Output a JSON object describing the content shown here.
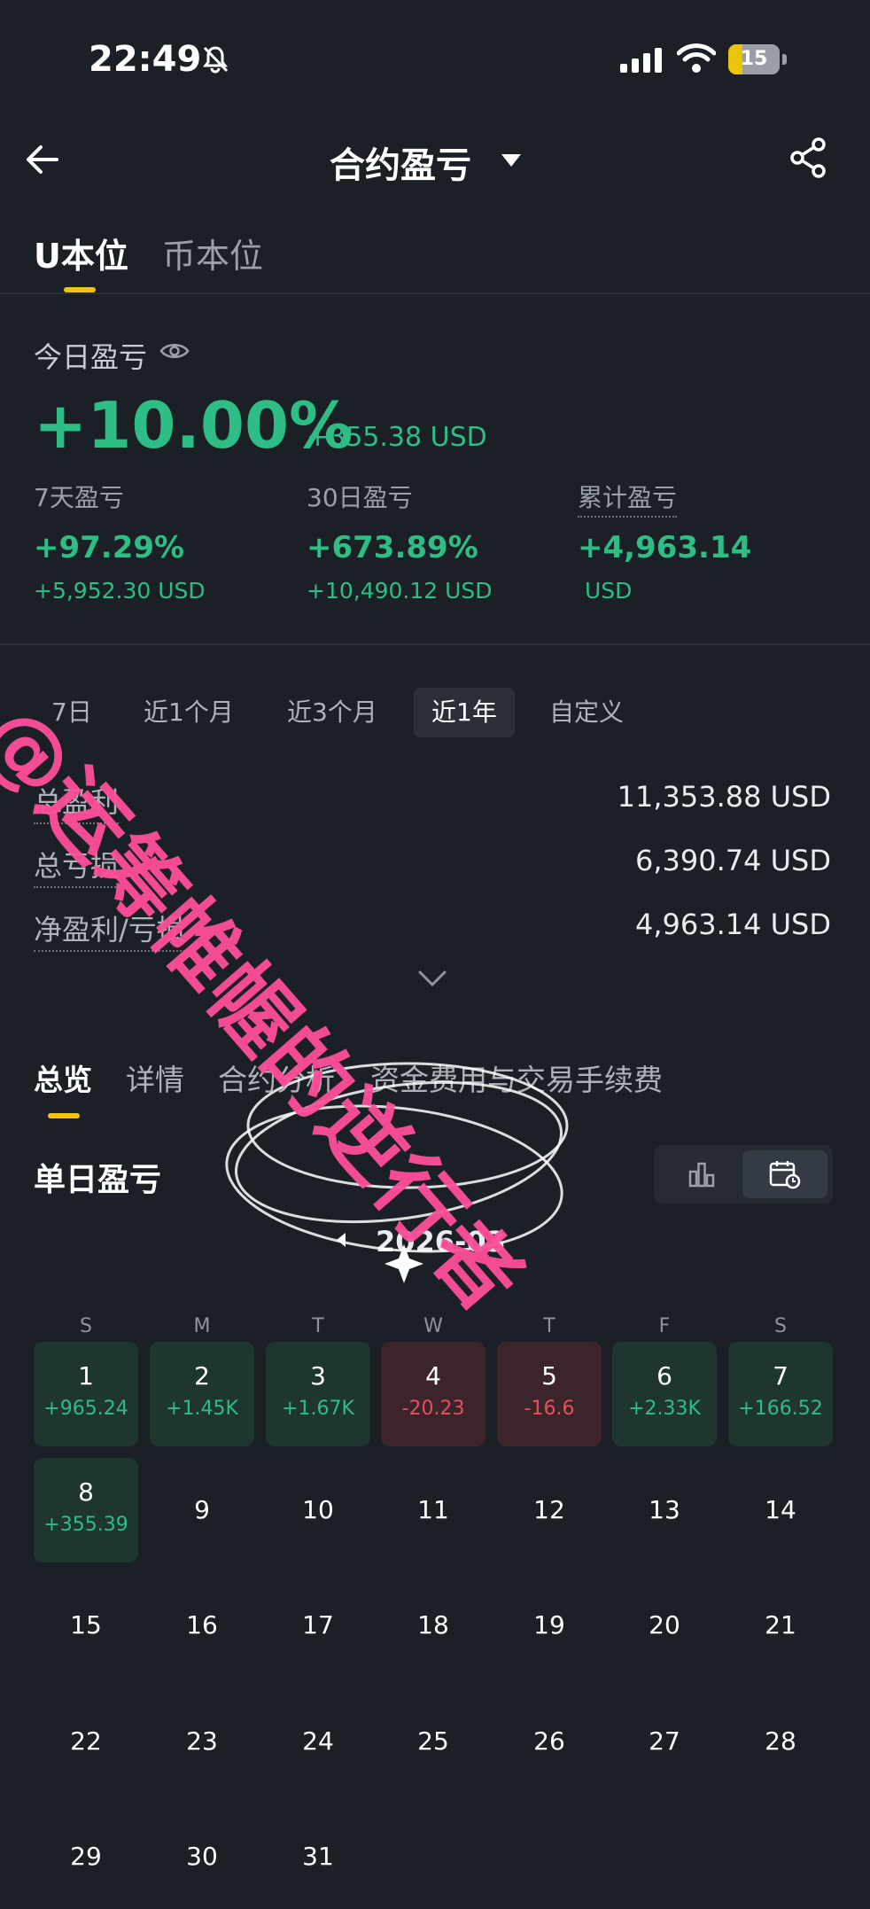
{
  "status": {
    "time": "22:49",
    "battery": "15"
  },
  "header": {
    "title": "合约盈亏"
  },
  "top_tabs": [
    "U本位",
    "币本位"
  ],
  "today": {
    "label": "今日盈亏",
    "pct": "+10.00%",
    "usd": "+355.38 USD"
  },
  "stats": [
    {
      "label": "7天盈亏",
      "pct": "+97.29%",
      "usd": "+5,952.30 USD"
    },
    {
      "label": "30日盈亏",
      "pct": "+673.89%",
      "usd": "+10,490.12 USD"
    },
    {
      "label": "累计盈亏",
      "pct": "+4,963.14",
      "usd": "USD"
    }
  ],
  "periods": [
    "7日",
    "近1个月",
    "近3个月",
    "近1年",
    "自定义"
  ],
  "summary": [
    {
      "label": "总盈利",
      "value": "11,353.88 USD"
    },
    {
      "label": "总亏损",
      "value": "6,390.74 USD"
    },
    {
      "label": "净盈利/亏损",
      "value": "4,963.14 USD"
    }
  ],
  "overview_tabs": [
    "总览",
    "详情",
    "合约分析",
    "资金费用与交易手续费"
  ],
  "daily": {
    "title": "单日盈亏",
    "month": "2026-03"
  },
  "weekdays": [
    "S",
    "M",
    "T",
    "W",
    "T",
    "F",
    "S"
  ],
  "days": [
    {
      "d": "1",
      "v": "+965.24",
      "t": "g"
    },
    {
      "d": "2",
      "v": "+1.45K",
      "t": "g"
    },
    {
      "d": "3",
      "v": "+1.67K",
      "t": "g"
    },
    {
      "d": "4",
      "v": "-20.23",
      "t": "r"
    },
    {
      "d": "5",
      "v": "-16.6",
      "t": "r"
    },
    {
      "d": "6",
      "v": "+2.33K",
      "t": "g"
    },
    {
      "d": "7",
      "v": "+166.52",
      "t": "g"
    },
    {
      "d": "8",
      "v": "+355.39",
      "t": "g"
    },
    {
      "d": "9"
    },
    {
      "d": "10"
    },
    {
      "d": "11"
    },
    {
      "d": "12"
    },
    {
      "d": "13"
    },
    {
      "d": "14"
    },
    {
      "d": "15"
    },
    {
      "d": "16"
    },
    {
      "d": "17"
    },
    {
      "d": "18"
    },
    {
      "d": "19"
    },
    {
      "d": "20"
    },
    {
      "d": "21"
    },
    {
      "d": "22"
    },
    {
      "d": "23"
    },
    {
      "d": "24"
    },
    {
      "d": "25"
    },
    {
      "d": "26"
    },
    {
      "d": "27"
    },
    {
      "d": "28"
    },
    {
      "d": "29"
    },
    {
      "d": "30"
    },
    {
      "d": "31"
    }
  ],
  "watermark": "@运筹帷幄的逆行者",
  "colors": {
    "up": "#2ebd85",
    "down": "#e84d62",
    "accent": "#f0c31a",
    "watermark": "#ff4f9a"
  }
}
